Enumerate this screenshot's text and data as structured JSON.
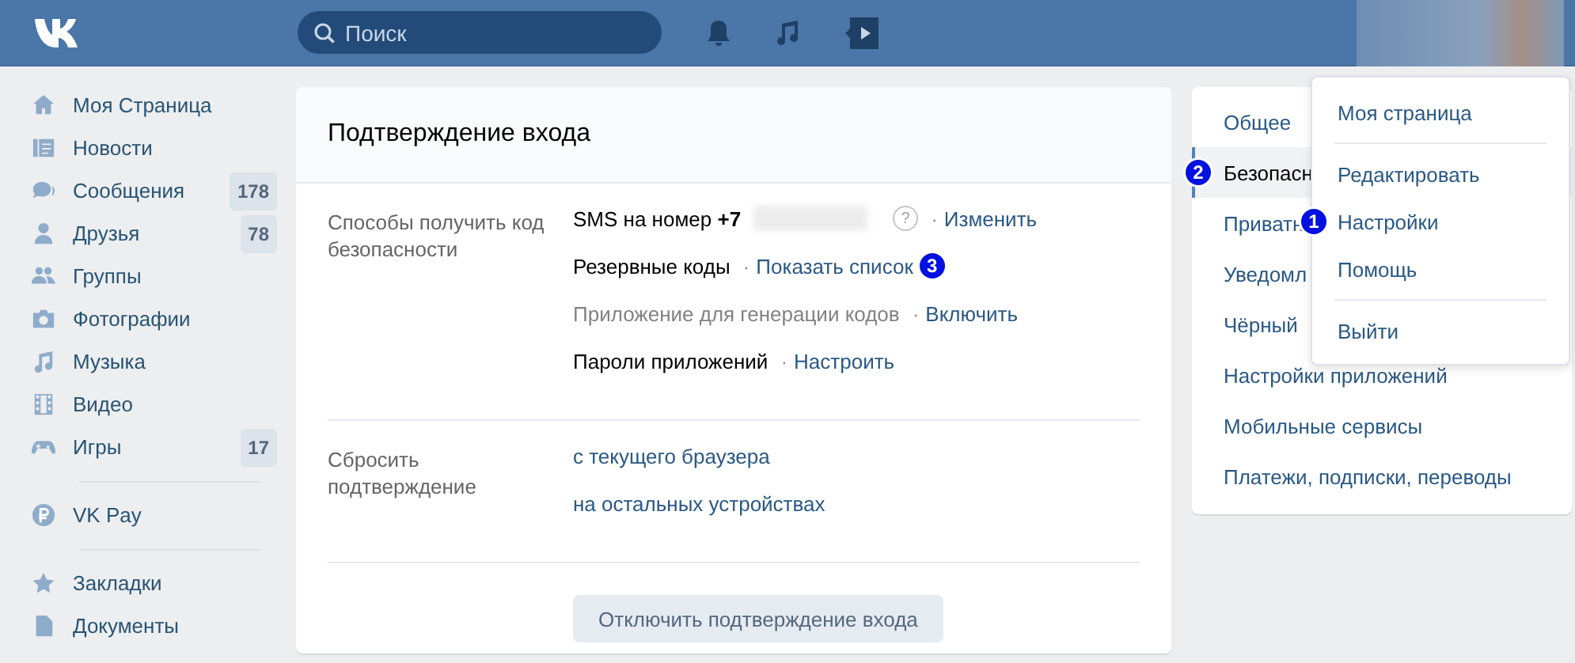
{
  "header": {
    "search": {
      "placeholder": "Поиск"
    }
  },
  "sidebar": {
    "items": [
      {
        "label": "Моя Страница"
      },
      {
        "label": "Новости"
      },
      {
        "label": "Сообщения",
        "count": "178"
      },
      {
        "label": "Друзья",
        "count": "78"
      },
      {
        "label": "Группы"
      },
      {
        "label": "Фотографии"
      },
      {
        "label": "Музыка"
      },
      {
        "label": "Видео"
      },
      {
        "label": "Игры",
        "count": "17"
      }
    ],
    "extra": [
      {
        "label": "VK Pay"
      }
    ],
    "more": [
      {
        "label": "Закладки"
      },
      {
        "label": "Документы"
      }
    ]
  },
  "card": {
    "title": "Подтверждение входа",
    "methods": {
      "label": "Способы получить код безопасности",
      "rows": [
        {
          "text": "SMS на номер **+7**",
          "enabled": true,
          "hidden_number": true,
          "help": "?",
          "separator": "·",
          "link": "Изменить"
        },
        {
          "text": "Резервные коды",
          "enabled": true,
          "separator": "·",
          "link": "Показать список",
          "marker": "3"
        },
        {
          "text": "Приложение для генерации кодов",
          "enabled": false,
          "separator": "·",
          "link": "Включить"
        },
        {
          "text": "Пароли приложений",
          "enabled": true,
          "separator": "·",
          "link": "Настроить"
        }
      ]
    },
    "reset": {
      "label": "Сбросить подтверждение",
      "links": [
        "с текущего браузера",
        "на остальных устройствах"
      ]
    },
    "button": "Отключить подтверждение входа"
  },
  "settings_menu": {
    "items": [
      {
        "label": "Общее",
        "selected": false
      },
      {
        "label": "Безопасн",
        "selected": true,
        "marker": "2"
      },
      {
        "label": "Приватн",
        "selected": false
      },
      {
        "label": "Уведомл",
        "selected": false
      },
      {
        "label": "Чёрный",
        "selected": false
      },
      {
        "label": "Настройки приложений",
        "selected": false
      },
      {
        "label": "Мобильные сервисы",
        "selected": false
      },
      {
        "label": "Платежи, подписки, переводы",
        "selected": false
      }
    ]
  },
  "profile_menu": {
    "groups": [
      [
        {
          "label": "Моя страница"
        }
      ],
      [
        {
          "label": "Редактировать"
        },
        {
          "label": "Настройки",
          "marker": "1"
        },
        {
          "label": "Помощь"
        }
      ],
      [
        {
          "label": "Выйти"
        }
      ]
    ]
  }
}
